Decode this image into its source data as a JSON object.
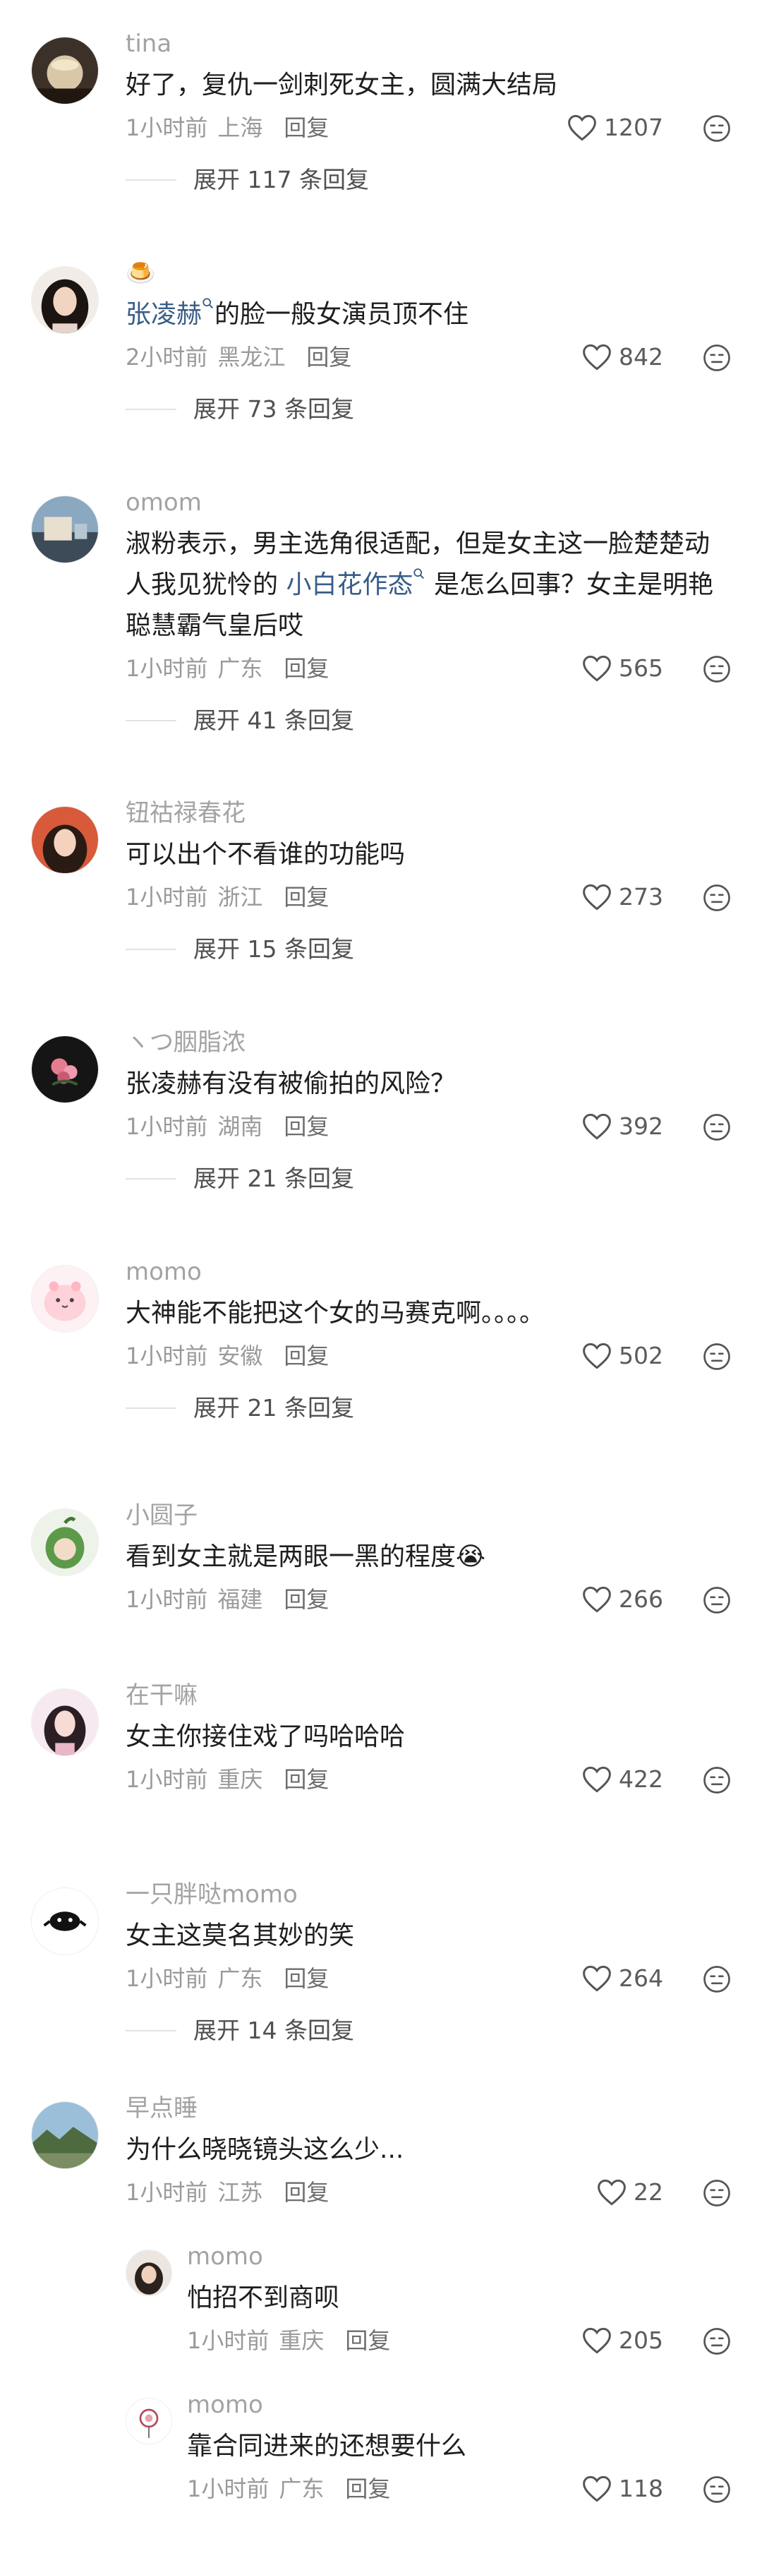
{
  "reply_label": "回复",
  "comments": [
    {
      "user": "tina",
      "text": "好了，复仇一剑刺死女主，圆满大结局",
      "time": "1小时前",
      "loc": "上海",
      "likes": "1207",
      "expand": "展开 117 条回复"
    },
    {
      "user": "",
      "user_emoji": "🍮",
      "mention": "张凌赫",
      "text_after": "的脸一般女演员顶不住",
      "time": "2小时前",
      "loc": "黑龙江",
      "likes": "842",
      "expand": "展开 73 条回复"
    },
    {
      "user": "omom",
      "text_before": "淑粉表示，男主选角很适配，但是女主这一脸楚楚动人我见犹怜的",
      "mention": "小白花作态",
      "text_after": "是怎么回事？女主是明艳聪慧霸气皇后哎",
      "time": "1小时前",
      "loc": "广东",
      "likes": "565",
      "expand": "展开 41 条回复"
    },
    {
      "user": "钮祜禄春花",
      "text": "可以出个不看谁的功能吗",
      "time": "1小时前",
      "loc": "浙江",
      "likes": "273",
      "expand": "展开 15 条回复"
    },
    {
      "user": "ヽつ胭脂浓",
      "text": "张凌赫有没有被偷拍的风险？",
      "time": "1小时前",
      "loc": "湖南",
      "likes": "392",
      "expand": "展开 21 条回复"
    },
    {
      "user": "momo",
      "text": "大神能不能把这个女的马赛克啊。。。。",
      "time": "1小时前",
      "loc": "安徽",
      "likes": "502",
      "expand": "展开 21 条回复"
    },
    {
      "user": "小圆子",
      "text": "看到女主就是两眼一黑的程度😭",
      "time": "1小时前",
      "loc": "福建",
      "likes": "266"
    },
    {
      "user": "在干嘛",
      "text": "女主你接住戏了吗哈哈哈",
      "time": "1小时前",
      "loc": "重庆",
      "likes": "422"
    },
    {
      "user": "一只胖哒momo",
      "text": "女主这莫名其妙的笑",
      "time": "1小时前",
      "loc": "广东",
      "likes": "264",
      "expand": "展开 14 条回复"
    },
    {
      "user": "早点睡",
      "text": "为什么晓晓镜头这么少...",
      "time": "1小时前",
      "loc": "江苏",
      "likes": "22"
    },
    {
      "user": "momo",
      "text": "怕招不到商呗",
      "time": "1小时前",
      "loc": "重庆",
      "likes": "205"
    },
    {
      "user": "momo",
      "text": "靠合同进来的还想要什么",
      "time": "1小时前",
      "loc": "广东",
      "likes": "118"
    }
  ]
}
